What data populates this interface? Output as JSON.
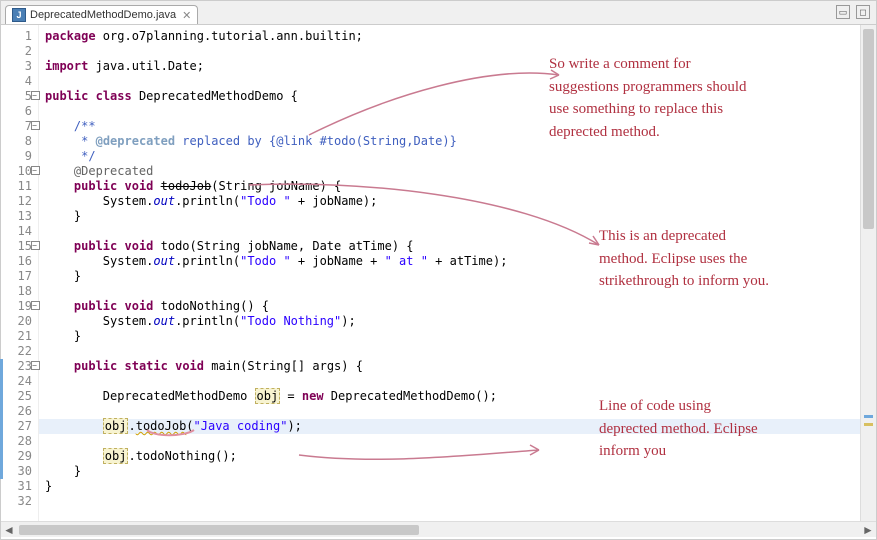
{
  "tab": {
    "filename": "DeprecatedMethodDemo.java",
    "icon_letter": "J"
  },
  "lines": [
    {
      "n": 1,
      "fold": "",
      "mark": "",
      "segments": [
        [
          "kw",
          "package"
        ],
        [
          "",
          " org.o7planning.tutorial.ann.builtin;"
        ]
      ]
    },
    {
      "n": 2,
      "fold": "",
      "mark": "",
      "segments": [
        [
          "",
          ""
        ]
      ]
    },
    {
      "n": 3,
      "fold": "",
      "mark": "",
      "segments": [
        [
          "kw",
          "import"
        ],
        [
          "",
          " java.util.Date;"
        ]
      ]
    },
    {
      "n": 4,
      "fold": "",
      "mark": "",
      "segments": [
        [
          "",
          ""
        ]
      ]
    },
    {
      "n": 5,
      "fold": "-",
      "mark": "",
      "segments": [
        [
          "kw",
          "public"
        ],
        [
          "",
          " "
        ],
        [
          "kw",
          "class"
        ],
        [
          "",
          " DeprecatedMethodDemo {"
        ]
      ]
    },
    {
      "n": 6,
      "fold": "",
      "mark": "",
      "segments": [
        [
          "",
          ""
        ]
      ]
    },
    {
      "n": 7,
      "fold": "-",
      "mark": "",
      "segments": [
        [
          "",
          "    "
        ],
        [
          "jdoc",
          "/**"
        ]
      ]
    },
    {
      "n": 8,
      "fold": "",
      "mark": "",
      "segments": [
        [
          "",
          "    "
        ],
        [
          "jdoc",
          " * "
        ],
        [
          "jdoc-tag",
          "@deprecated"
        ],
        [
          "jdoc",
          " replaced by "
        ],
        [
          "jdoc-link",
          "{@link #todo(String,Date)}"
        ]
      ]
    },
    {
      "n": 9,
      "fold": "",
      "mark": "",
      "segments": [
        [
          "",
          "    "
        ],
        [
          "jdoc",
          " */"
        ]
      ]
    },
    {
      "n": 10,
      "fold": "-",
      "mark": "",
      "segments": [
        [
          "",
          "    "
        ],
        [
          "ann",
          "@Deprecated"
        ]
      ]
    },
    {
      "n": 11,
      "fold": "",
      "mark": "",
      "segments": [
        [
          "",
          "    "
        ],
        [
          "kw",
          "public"
        ],
        [
          "",
          " "
        ],
        [
          "kw",
          "void"
        ],
        [
          "",
          " "
        ],
        [
          "deprec",
          "todoJob"
        ],
        [
          "",
          "(String jobName) {"
        ]
      ]
    },
    {
      "n": 12,
      "fold": "",
      "mark": "",
      "segments": [
        [
          "",
          "        System."
        ],
        [
          "field",
          "out"
        ],
        [
          "",
          ".println("
        ],
        [
          "str",
          "\"Todo \""
        ],
        [
          "",
          " + jobName);"
        ]
      ]
    },
    {
      "n": 13,
      "fold": "",
      "mark": "",
      "segments": [
        [
          "",
          "    }"
        ]
      ]
    },
    {
      "n": 14,
      "fold": "",
      "mark": "",
      "segments": [
        [
          "",
          ""
        ]
      ]
    },
    {
      "n": 15,
      "fold": "-",
      "mark": "",
      "segments": [
        [
          "",
          "    "
        ],
        [
          "kw",
          "public"
        ],
        [
          "",
          " "
        ],
        [
          "kw",
          "void"
        ],
        [
          "",
          " todo(String jobName, Date atTime) {"
        ]
      ]
    },
    {
      "n": 16,
      "fold": "",
      "mark": "",
      "segments": [
        [
          "",
          "        System."
        ],
        [
          "field",
          "out"
        ],
        [
          "",
          ".println("
        ],
        [
          "str",
          "\"Todo \""
        ],
        [
          "",
          " + jobName + "
        ],
        [
          "str",
          "\" at \""
        ],
        [
          "",
          " + atTime);"
        ]
      ]
    },
    {
      "n": 17,
      "fold": "",
      "mark": "",
      "segments": [
        [
          "",
          "    }"
        ]
      ]
    },
    {
      "n": 18,
      "fold": "",
      "mark": "",
      "segments": [
        [
          "",
          ""
        ]
      ]
    },
    {
      "n": 19,
      "fold": "-",
      "mark": "",
      "segments": [
        [
          "",
          "    "
        ],
        [
          "kw",
          "public"
        ],
        [
          "",
          " "
        ],
        [
          "kw",
          "void"
        ],
        [
          "",
          " todoNothing() {"
        ]
      ]
    },
    {
      "n": 20,
      "fold": "",
      "mark": "",
      "segments": [
        [
          "",
          "        System."
        ],
        [
          "field",
          "out"
        ],
        [
          "",
          ".println("
        ],
        [
          "str",
          "\"Todo Nothing\""
        ],
        [
          "",
          ");"
        ]
      ]
    },
    {
      "n": 21,
      "fold": "",
      "mark": "",
      "segments": [
        [
          "",
          "    }"
        ]
      ]
    },
    {
      "n": 22,
      "fold": "",
      "mark": "",
      "segments": [
        [
          "",
          ""
        ]
      ]
    },
    {
      "n": 23,
      "fold": "-",
      "mark": "blue",
      "segments": [
        [
          "",
          "    "
        ],
        [
          "kw",
          "public"
        ],
        [
          "",
          " "
        ],
        [
          "kw",
          "static"
        ],
        [
          "",
          " "
        ],
        [
          "kw",
          "void"
        ],
        [
          "",
          " main(String[] args) {"
        ]
      ]
    },
    {
      "n": 24,
      "fold": "",
      "mark": "blue",
      "segments": [
        [
          "",
          ""
        ]
      ]
    },
    {
      "n": 25,
      "fold": "",
      "mark": "blue",
      "segments": [
        [
          "",
          "        DeprecatedMethodDemo "
        ],
        [
          "warn",
          "obj"
        ],
        [
          "",
          " = "
        ],
        [
          "kw",
          "new"
        ],
        [
          "",
          " DeprecatedMethodDemo();"
        ]
      ]
    },
    {
      "n": 26,
      "fold": "",
      "mark": "blue",
      "segments": [
        [
          "",
          ""
        ]
      ]
    },
    {
      "n": 27,
      "fold": "",
      "mark": "blue",
      "hl": true,
      "segments": [
        [
          "",
          "        "
        ],
        [
          "warn",
          "obj"
        ],
        [
          "",
          "."
        ],
        [
          "deprec-wavy",
          "todoJob"
        ],
        [
          "",
          "("
        ],
        [
          "str",
          "\"Java coding\""
        ],
        [
          "",
          ");"
        ]
      ]
    },
    {
      "n": 28,
      "fold": "",
      "mark": "blue",
      "segments": [
        [
          "",
          ""
        ]
      ]
    },
    {
      "n": 29,
      "fold": "",
      "mark": "blue",
      "segments": [
        [
          "",
          "        "
        ],
        [
          "warn",
          "obj"
        ],
        [
          "",
          ".todoNothing();"
        ]
      ]
    },
    {
      "n": 30,
      "fold": "",
      "mark": "blue",
      "segments": [
        [
          "",
          "    }"
        ]
      ]
    },
    {
      "n": 31,
      "fold": "",
      "mark": "",
      "segments": [
        [
          "",
          "}"
        ]
      ]
    },
    {
      "n": 32,
      "fold": "",
      "mark": "",
      "segments": [
        [
          "",
          ""
        ]
      ]
    }
  ],
  "annotations": {
    "a1": "So write a comment for\nsuggestions programmers should\nuse something to replace this\ndeprected method.",
    "a2": "This is an deprecated\nmethod. Eclipse uses the\nstrikethrough to inform you.",
    "a3": "Line of code using\ndeprected method. Eclipse\ninform you"
  }
}
